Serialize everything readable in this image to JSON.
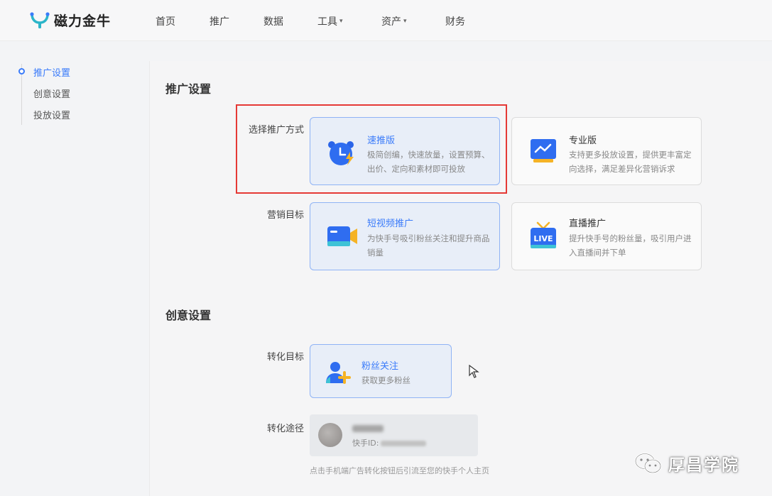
{
  "brand": {
    "name": "磁力金牛",
    "accent": "#2bb5c9"
  },
  "nav": {
    "items": [
      {
        "label": "首页"
      },
      {
        "label": "推广"
      },
      {
        "label": "数据"
      },
      {
        "label": "工具",
        "dropdown": true
      },
      {
        "label": "资产",
        "dropdown": true
      },
      {
        "label": "财务"
      }
    ]
  },
  "sidebar": {
    "items": [
      {
        "label": "推广设置",
        "active": true
      },
      {
        "label": "创意设置"
      },
      {
        "label": "投放设置"
      }
    ]
  },
  "promotion": {
    "title": "推广设置",
    "method_label": "选择推广方式",
    "methods": [
      {
        "title": "速推版",
        "desc": "极简创编，快速放量，设置预算、出价、定向和素材即可投放",
        "selected": true,
        "icon": "clock-bolt-icon"
      },
      {
        "title": "专业版",
        "desc": "支持更多投放设置，提供更丰富定向选择，满足差异化营销诉求",
        "selected": false,
        "icon": "monitor-chart-icon"
      }
    ],
    "goal_label": "营销目标",
    "goals": [
      {
        "title": "短视频推广",
        "desc": "为快手号吸引粉丝关注和提升商品销量",
        "selected": true,
        "icon": "video-camera-icon"
      },
      {
        "title": "直播推广",
        "desc": "提升快手号的粉丝量，吸引用户进入直播间并下单",
        "selected": false,
        "icon": "live-tv-icon",
        "icon_text": "LIVE"
      }
    ]
  },
  "creative": {
    "title": "创意设置",
    "conversion_label": "转化目标",
    "conversion": {
      "title": "粉丝关注",
      "desc": "获取更多粉丝",
      "icon": "user-add-icon"
    },
    "path_label": "转化途径",
    "path": {
      "id_label": "快手ID:"
    },
    "hint": "点击手机端广告转化按钮后引流至您的快手个人主页"
  },
  "watermark": {
    "text": "厚昌学院",
    "icon": "wechat-icon"
  },
  "colors": {
    "primary": "#3a7bfa",
    "selected_bg": "#e8eef8",
    "highlight": "#e53935"
  }
}
